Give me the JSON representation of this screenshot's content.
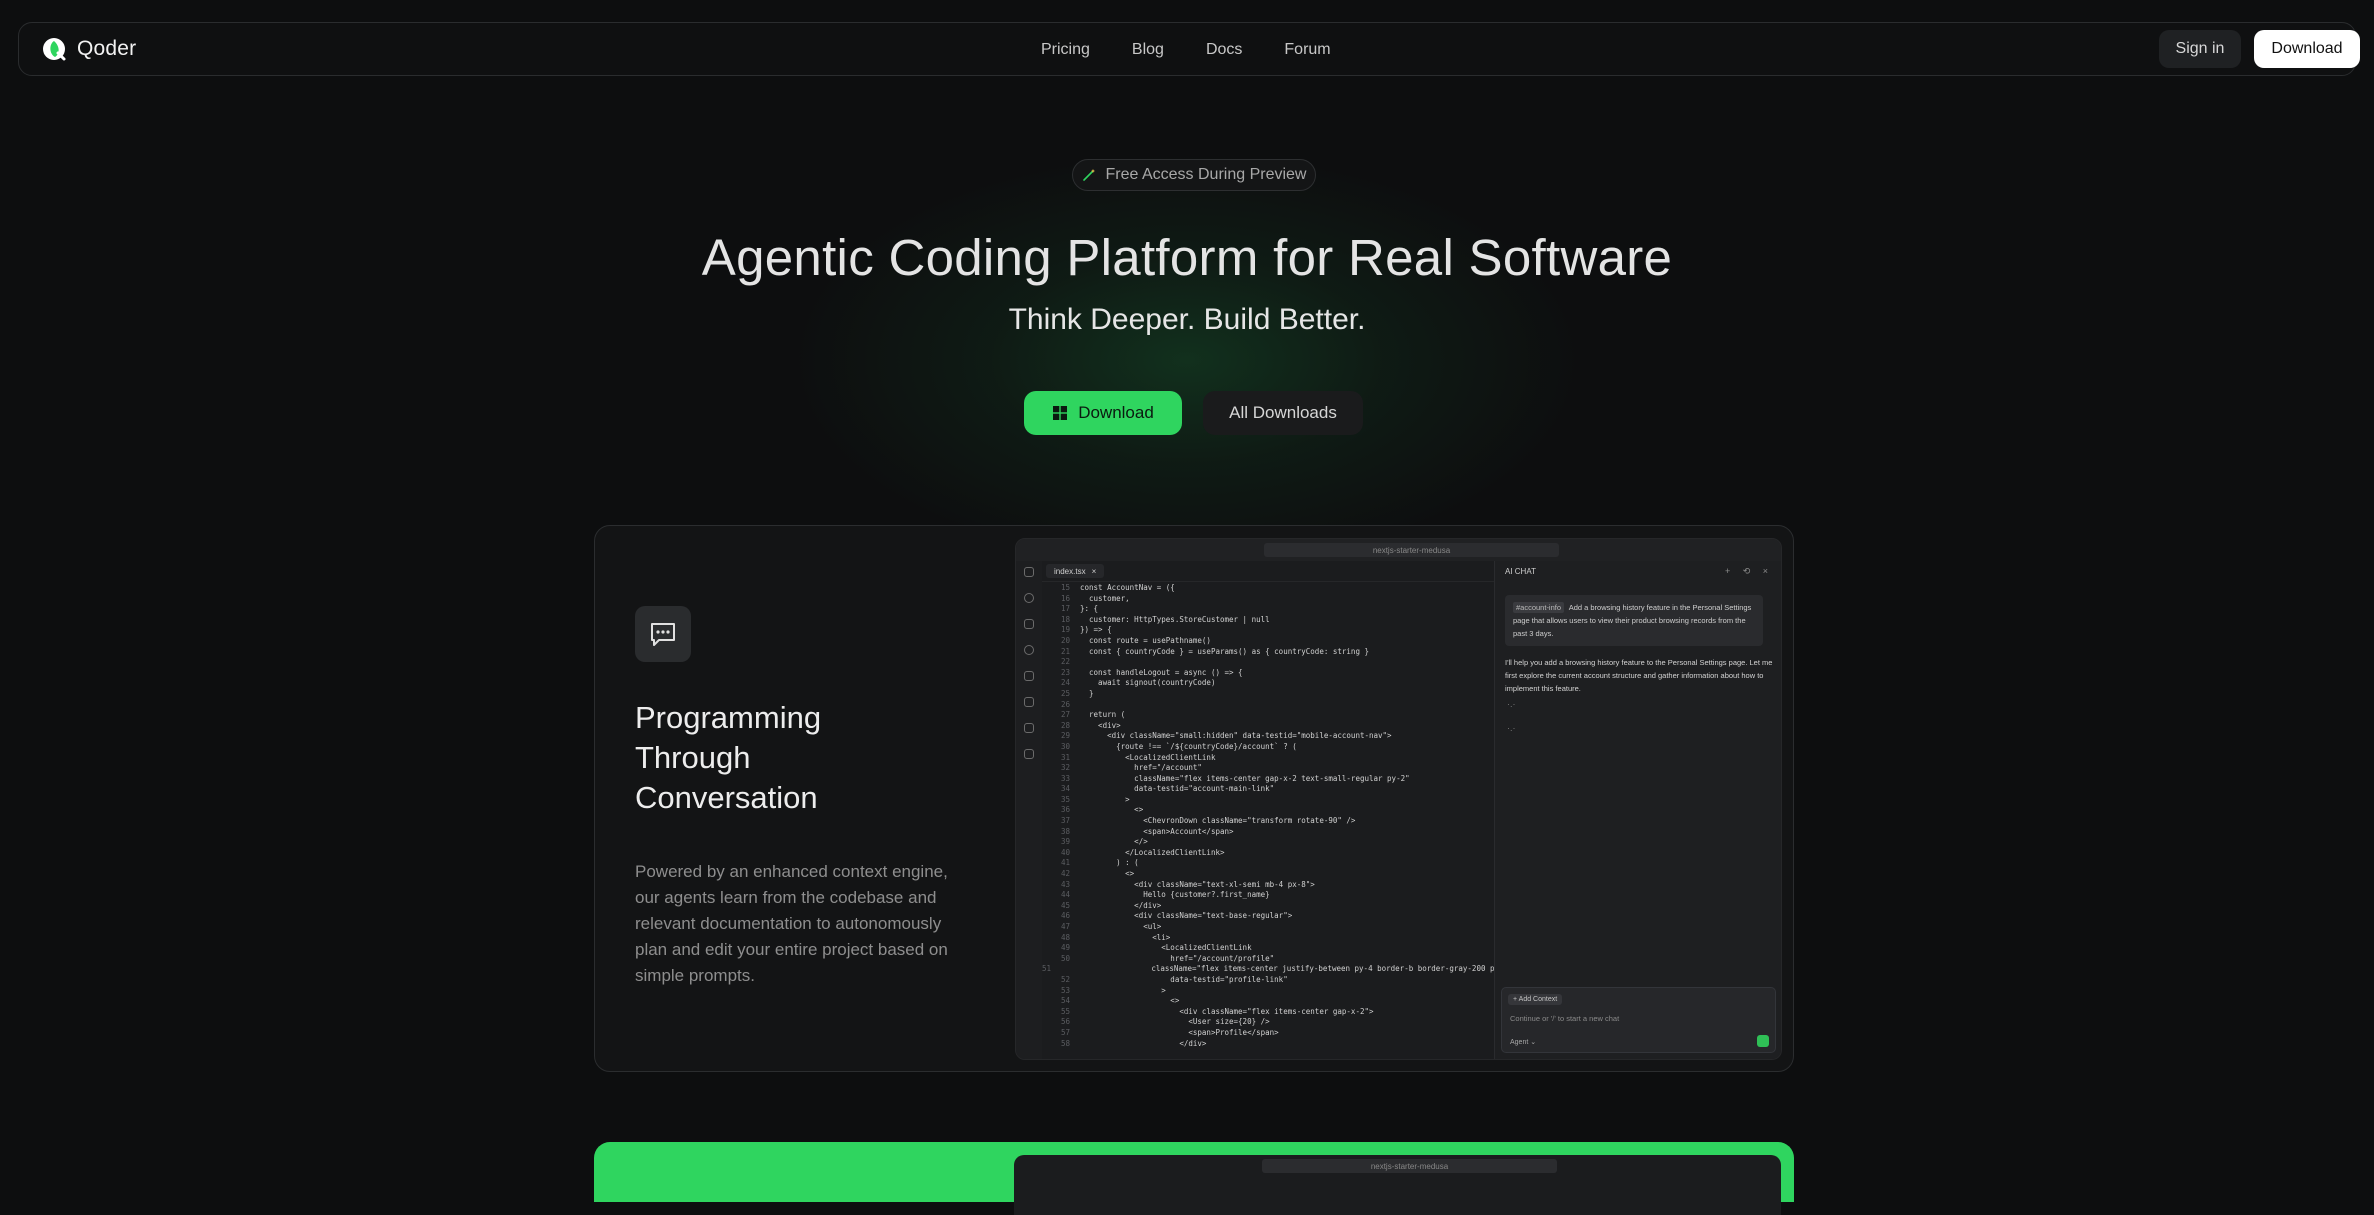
{
  "brand": {
    "name": "Qoder"
  },
  "nav": {
    "links": [
      "Pricing",
      "Blog",
      "Docs",
      "Forum"
    ],
    "sign_in": "Sign in",
    "download": "Download"
  },
  "hero": {
    "badge": "Free Access During Preview",
    "title": "Agentic Coding Platform for Real Software",
    "subtitle": "Think Deeper. Build Better.",
    "download_label": "Download",
    "all_downloads_label": "All Downloads"
  },
  "feature": {
    "title": "Programming Through Conversation",
    "description": "Powered by an enhanced context engine, our agents learn from the codebase and relevant documentation to autonomously plan and edit your entire project based on simple prompts."
  },
  "ide": {
    "search": "nextjs-starter-medusa",
    "tab": "index.tsx",
    "chat_title": "AI CHAT",
    "user_chip": "#account-info",
    "user_message": "Add a browsing history feature in the Personal Settings page that allows users to view their product browsing records from the past 3 days.",
    "assistant_message": "I'll help you add a browsing history feature to the Personal Settings page. Let me first explore the current account structure and gather information about how to implement this feature.",
    "add_context": "+ Add Context",
    "input_placeholder": "Continue or '/' to start a new chat",
    "agent_label": "Agent ⌄",
    "code": [
      {
        "n": "15",
        "t": "const AccountNav = ({"
      },
      {
        "n": "16",
        "t": "  customer,"
      },
      {
        "n": "17",
        "t": "}: {"
      },
      {
        "n": "18",
        "t": "  customer: HttpTypes.StoreCustomer | null"
      },
      {
        "n": "19",
        "t": "}) => {"
      },
      {
        "n": "20",
        "t": "  const route = usePathname()"
      },
      {
        "n": "21",
        "t": "  const { countryCode } = useParams() as { countryCode: string }"
      },
      {
        "n": "22",
        "t": ""
      },
      {
        "n": "23",
        "t": "  const handleLogout = async () => {"
      },
      {
        "n": "24",
        "t": "    await signout(countryCode)"
      },
      {
        "n": "25",
        "t": "  }"
      },
      {
        "n": "26",
        "t": ""
      },
      {
        "n": "27",
        "t": "  return ("
      },
      {
        "n": "28",
        "t": "    <div>"
      },
      {
        "n": "29",
        "t": "      <div className=\"small:hidden\" data-testid=\"mobile-account-nav\">"
      },
      {
        "n": "30",
        "t": "        {route !== `/${countryCode}/account` ? ("
      },
      {
        "n": "31",
        "t": "          <LocalizedClientLink"
      },
      {
        "n": "32",
        "t": "            href=\"/account\""
      },
      {
        "n": "33",
        "t": "            className=\"flex items-center gap-x-2 text-small-regular py-2\""
      },
      {
        "n": "34",
        "t": "            data-testid=\"account-main-link\""
      },
      {
        "n": "35",
        "t": "          >"
      },
      {
        "n": "36",
        "t": "            <>"
      },
      {
        "n": "37",
        "t": "              <ChevronDown className=\"transform rotate-90\" />"
      },
      {
        "n": "38",
        "t": "              <span>Account</span>"
      },
      {
        "n": "39",
        "t": "            </>"
      },
      {
        "n": "40",
        "t": "          </LocalizedClientLink>"
      },
      {
        "n": "41",
        "t": "        ) : ("
      },
      {
        "n": "42",
        "t": "          <>"
      },
      {
        "n": "43",
        "t": "            <div className=\"text-xl-semi mb-4 px-8\">"
      },
      {
        "n": "44",
        "t": "              Hello {customer?.first_name}"
      },
      {
        "n": "45",
        "t": "            </div>"
      },
      {
        "n": "46",
        "t": "            <div className=\"text-base-regular\">"
      },
      {
        "n": "47",
        "t": "              <ul>"
      },
      {
        "n": "48",
        "t": "                <li>"
      },
      {
        "n": "49",
        "t": "                  <LocalizedClientLink"
      },
      {
        "n": "50",
        "t": "                    href=\"/account/profile\""
      },
      {
        "n": "51",
        "t": "                    className=\"flex items-center justify-between py-4 border-b border-gray-200 px-8\""
      },
      {
        "n": "52",
        "t": "                    data-testid=\"profile-link\""
      },
      {
        "n": "53",
        "t": "                  >"
      },
      {
        "n": "54",
        "t": "                    <>"
      },
      {
        "n": "55",
        "t": "                      <div className=\"flex items-center gap-x-2\">"
      },
      {
        "n": "56",
        "t": "                        <User size={20} />"
      },
      {
        "n": "57",
        "t": "                        <span>Profile</span>"
      },
      {
        "n": "58",
        "t": "                      </div>"
      }
    ]
  },
  "colors": {
    "accent": "#2fd55f",
    "background": "#0d0e0f"
  }
}
